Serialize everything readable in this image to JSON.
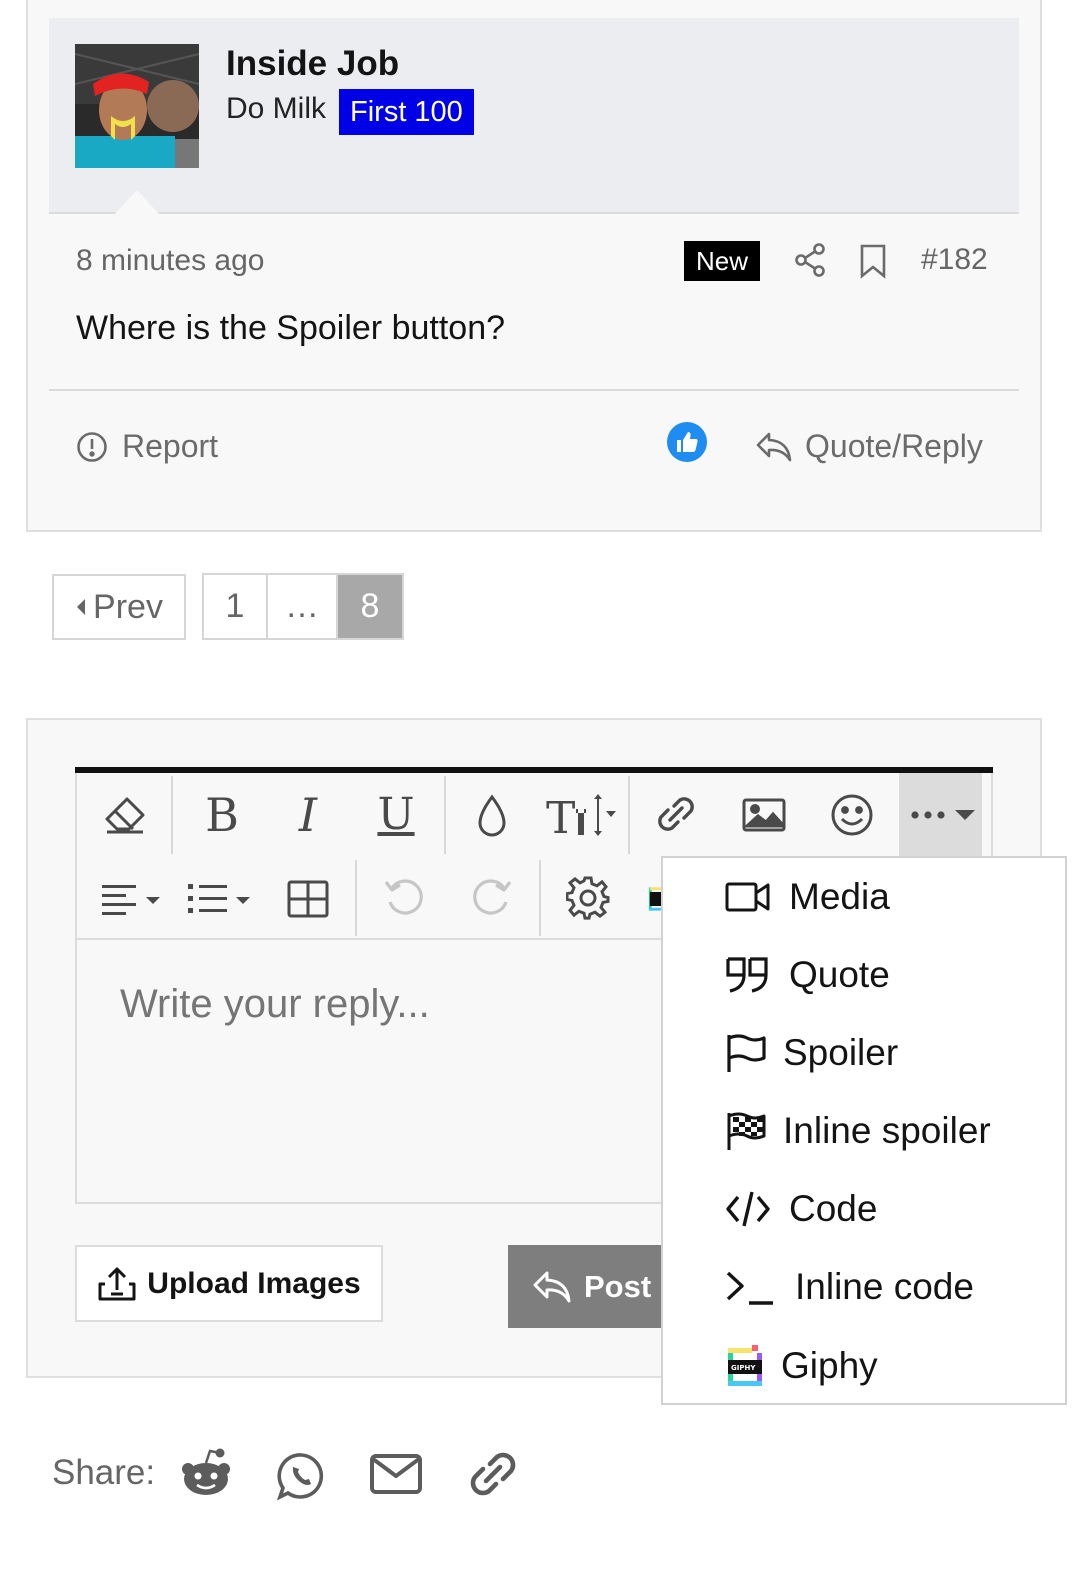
{
  "post": {
    "username": "Inside Job",
    "user_title": "Do Milk",
    "user_badge": "First 100",
    "timestamp": "8 minutes ago",
    "new_label": "New",
    "post_number": "#182",
    "body": "Where is the Spoiler button?",
    "report_label": "Report",
    "quote_reply_label": "Quote/Reply",
    "icons": [
      "share-icon",
      "bookmark-icon",
      "report-icon",
      "like-icon",
      "reply-icon"
    ],
    "colors": {
      "badge": "#0000e6",
      "like": "#1e8cf0",
      "new_badge": "#000000"
    }
  },
  "pagination": {
    "prev_label": "Prev",
    "pages": [
      "1",
      "…",
      "8"
    ],
    "current": "8"
  },
  "editor": {
    "placeholder": "Write your reply...",
    "upload_label": "Upload Images",
    "post_label": "Post",
    "toolbar_row1": [
      "eraser-icon",
      "bold-icon",
      "italic-icon",
      "underline-icon",
      "text-color-icon",
      "font-size-icon",
      "link-icon",
      "image-icon",
      "emoji-icon",
      "more-options-icon"
    ],
    "toolbar_row2": [
      "align-icon",
      "list-icon",
      "table-icon",
      "undo-icon",
      "redo-icon",
      "settings-icon"
    ]
  },
  "more_menu": {
    "items": [
      {
        "label": "Media",
        "icon": "video-icon"
      },
      {
        "label": "Quote",
        "icon": "quote-icon"
      },
      {
        "label": "Spoiler",
        "icon": "flag-icon"
      },
      {
        "label": "Inline spoiler",
        "icon": "checkered-flag-icon"
      },
      {
        "label": "Code",
        "icon": "code-icon"
      },
      {
        "label": "Inline code",
        "icon": "terminal-icon"
      },
      {
        "label": "Giphy",
        "icon": "giphy-icon"
      }
    ]
  },
  "share": {
    "label": "Share:",
    "icons": [
      "reddit-icon",
      "whatsapp-icon",
      "email-icon",
      "link-icon"
    ]
  }
}
